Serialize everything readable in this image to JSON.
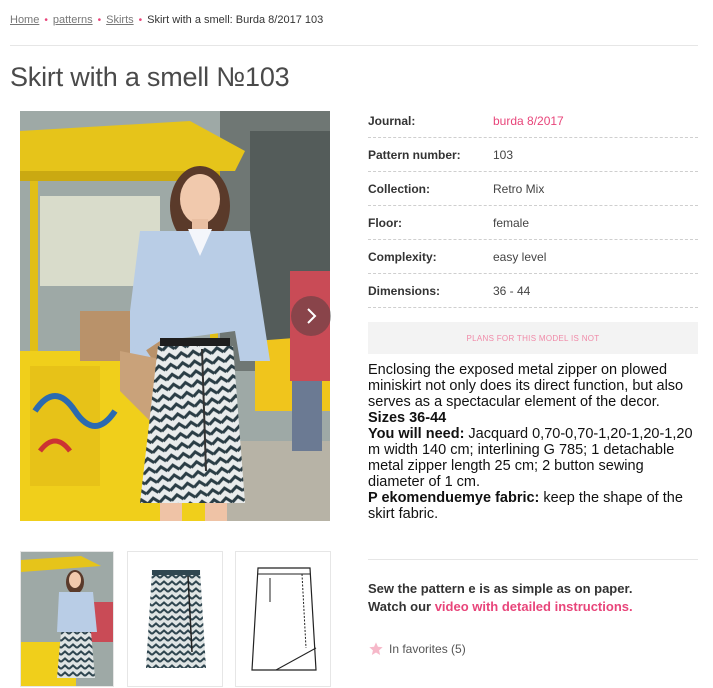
{
  "breadcrumb": {
    "items": [
      "Home",
      "patterns",
      "Skirts"
    ],
    "current": "Skirt with a smell: Burda 8/2017 103"
  },
  "page_title": "Skirt with a smell №103",
  "specs": [
    {
      "label": "Journal:",
      "value": "burda 8/2017"
    },
    {
      "label": "Pattern number:",
      "value": "103"
    },
    {
      "label": "Collection:",
      "value": "Retro Mix"
    },
    {
      "label": "Floor:",
      "value": "female"
    },
    {
      "label": "Complexity:",
      "value": "easy level"
    },
    {
      "label": "Dimensions:",
      "value": "36 - 44"
    }
  ],
  "plans_notice": "PLANS FOR THIS MODEL IS NOT",
  "description": {
    "intro": "Enclosing the exposed metal zipper on plowed miniskirt not only does its direct function, but also serves as a spectacular element of the decor.",
    "sizes": "Sizes 36-44",
    "need_label": "You will need:",
    "need_text": " Jacquard 0,70-0,70-1,20-1,20-1,20 m width 140 cm; interlining G 785; 1 detachable metal zipper length 25 cm; 2 button sewing diameter of 1 cm.",
    "fabric_label": "P ekomenduemye fabric:",
    "fabric_text": " keep the shape of the skirt fabric."
  },
  "sew": {
    "line1": "Sew the pattern e is as simple as on paper.",
    "line2_prefix": "Watch our ",
    "line2_link": "video with detailed instructions."
  },
  "favorites": "In favorites (5)",
  "icons": [
    "chevron-right-icon",
    "star-icon"
  ],
  "colors": {
    "accent": "#e8457a",
    "cart_yellow": "#f2d21c",
    "shirt": "#b9cde6"
  }
}
